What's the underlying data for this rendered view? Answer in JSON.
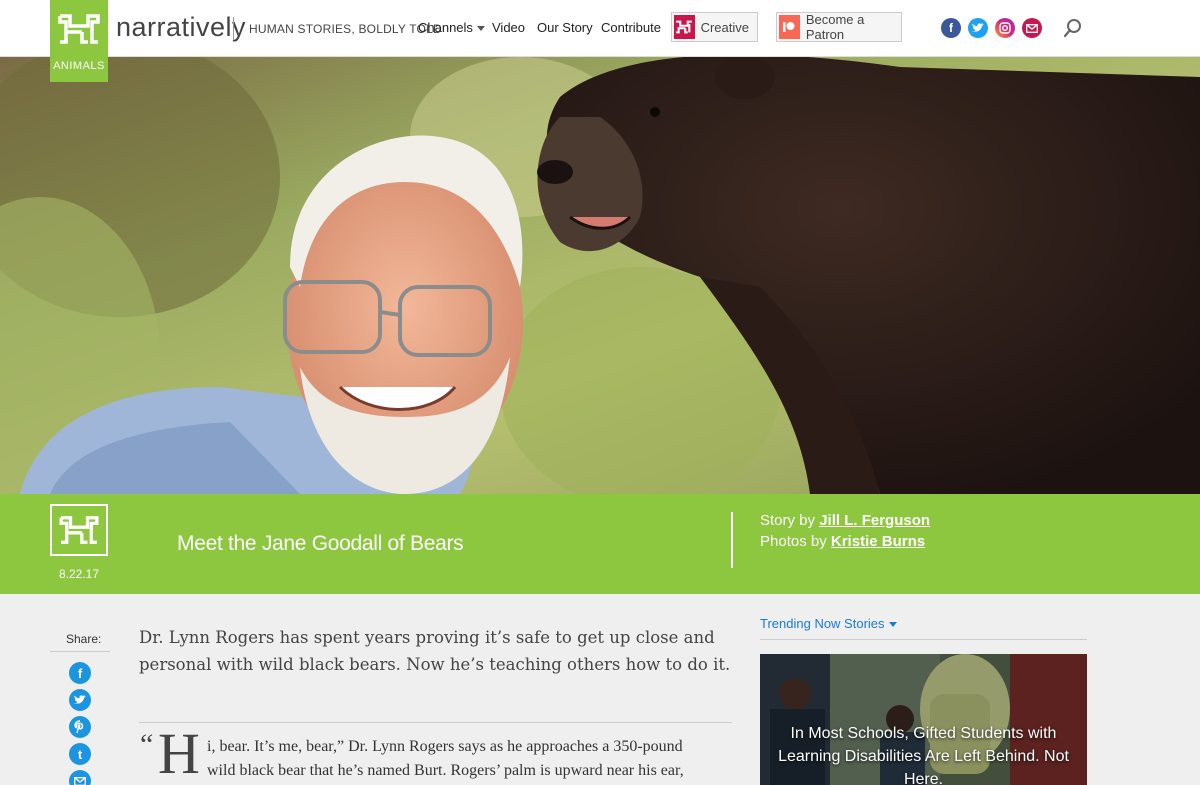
{
  "header": {
    "brand_name": "narratively",
    "tagline": "HUMAN STORIES, BOLDLY TOLD",
    "channel_tag": "ANIMALS",
    "nav": {
      "channels": "Channels",
      "video": "Video",
      "our_story": "Our Story",
      "contribute": "Contribute"
    },
    "creative_label": "Creative",
    "patron_label": "Become a Patron",
    "social": [
      "facebook-icon",
      "twitter-icon",
      "instagram-icon",
      "email-icon"
    ],
    "brand_color": "#8dc63f"
  },
  "article": {
    "date": "8.22.17",
    "title": "Meet the Jane Goodall of Bears",
    "story_by_prefix": "Story by",
    "author": "Jill L. Ferguson",
    "photos_by_prefix": "Photos by",
    "photographer": "Kristie Burns",
    "dek": "Dr. Lynn Rogers has spent years proving it’s safe to get up close and personal with wild black bears. Now he’s teaching others how to do it.",
    "opening_quote": "“",
    "drop_cap": "H",
    "body_line_1": "i, bear. It’s me, bear,” Dr. Lynn Rogers says as he approaches a 350-pound",
    "body_line_2": "wild black bear that he’s named Burt. Rogers’ palm is upward near his ear,"
  },
  "share": {
    "label": "Share:",
    "buttons": [
      "facebook-icon",
      "twitter-icon",
      "pinterest-icon",
      "tumblr-icon",
      "email-icon"
    ]
  },
  "sidebar": {
    "trending_label": "Trending Now Stories",
    "card_title": "In Most Schools, Gifted Students with Learning Disabilities Are Left Behind. Not Here."
  }
}
